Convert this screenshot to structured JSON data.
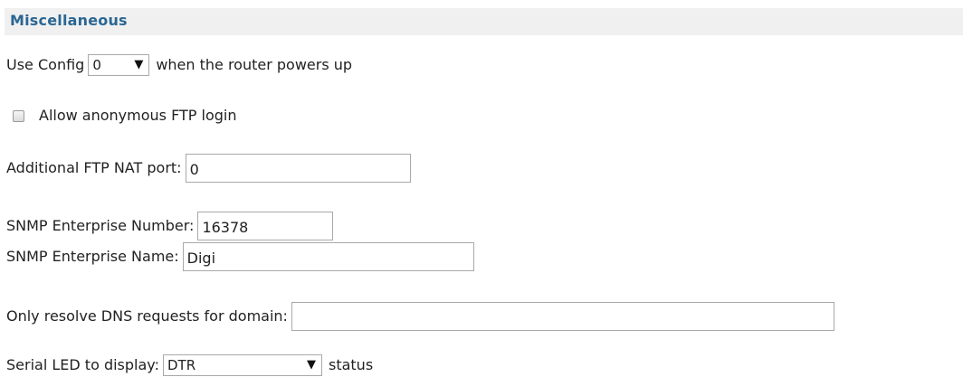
{
  "section": {
    "title": "Miscellaneous"
  },
  "use_config": {
    "prefix": "Use Config",
    "selected": "0",
    "suffix": "when the router powers up"
  },
  "anonymous_ftp": {
    "label": "Allow anonymous FTP login",
    "checked": false
  },
  "ftp_nat_port": {
    "label": "Additional FTP NAT port:",
    "value": "0"
  },
  "snmp": {
    "number_label": "SNMP Enterprise Number:",
    "number_value": "16378",
    "name_label": "SNMP Enterprise Name:",
    "name_value": "Digi"
  },
  "dns_domain": {
    "label": "Only resolve DNS requests for domain:",
    "value": ""
  },
  "serial_led": {
    "label": "Serial LED to display:",
    "selected": "DTR",
    "suffix": "status"
  },
  "icons": {
    "dropdown": "triangle-down"
  }
}
